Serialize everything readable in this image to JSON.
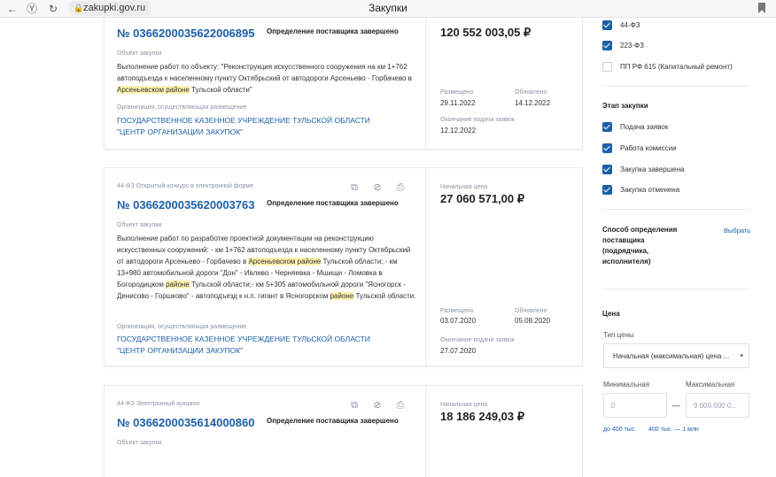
{
  "browser": {
    "url": "zakupki.gov.ru",
    "tab_title": "Закупки"
  },
  "cards": [
    {
      "reg_number": "№ 0366200035622006895",
      "status": "Определение поставщика завершено",
      "obj_label": "Объект закупки",
      "obj_text_parts": [
        "Выполнение работ по объекту: \"Реконструкция искусственного сооружения на км 1+762 автоподъезда к населенному пункту Октябрьский от автодороги Арсеньево - Горбачево в ",
        "Арсеньевском районе",
        " Тульской области\""
      ],
      "org_label": "Организация, осуществляющая размещение",
      "org_name": "ГОСУДАРСТВЕННОЕ КАЗЕННОЕ УЧРЕЖДЕНИЕ ТУЛЬСКОЙ ОБЛАСТИ \"ЦЕНТР ОРГАНИЗАЦИИ ЗАКУПОК\"",
      "price": "120 552 003,05 ₽",
      "placed_label": "Размещено",
      "placed": "29.11.2022",
      "updated_label": "Обновлено",
      "updated": "14.12.2022",
      "deadline_label": "Окончание подачи заявок",
      "deadline": "12.12.2022"
    },
    {
      "law_type": "44-ФЗ Открытый конкурс в электронной форме",
      "reg_number": "№ 0366200035620003763",
      "status": "Определение поставщика завершено",
      "obj_label": "Объект закупки",
      "obj_text_parts": [
        "Выполнение работ по разработке проектной документации на реконструкцию искусственных сооружений: - км 1+762 автоподъезда к населенному пункту Октябрьский от автодороги Арсеньево - Горбачево в ",
        "Арсеньевском районе",
        " Тульской области; - км 13+980 автомобильной дороги \"Дон\" - Ивлево - Черняевка - Мшищи - Ломовка в Богородицком ",
        "районе",
        " Тульской области;- км 5+305 автомобильной дороги \"Ясногорск - Денисово - Горшково\" - автоподъезд к н.п. гигант в Ясногорском ",
        "районе",
        " Тульской области."
      ],
      "org_label": "Организация, осуществляющая размещение",
      "org_name": "ГОСУДАРСТВЕННОЕ КАЗЕННОЕ УЧРЕЖДЕНИЕ ТУЛЬСКОЙ ОБЛАСТИ \"ЦЕНТР ОРГАНИЗАЦИИ ЗАКУПОК\"",
      "price_label": "Начальная цена",
      "price": "27 060 571,00 ₽",
      "placed_label": "Размещено",
      "placed": "03.07.2020",
      "updated_label": "Обновлено",
      "updated": "05.08.2020",
      "deadline_label": "Окончание подачи заявок",
      "deadline": "27.07.2020"
    },
    {
      "law_type": "44-ФЗ Электронный аукцион",
      "reg_number": "№ 0366200035614000860",
      "status": "Определение поставщика завершено",
      "obj_label": "Объект закупки",
      "price_label": "Начальная цена",
      "price": "18 186 249,03 ₽"
    }
  ],
  "sidebar": {
    "law_filters": [
      {
        "label": "44-ФЗ",
        "checked": true
      },
      {
        "label": "223-ФЗ",
        "checked": true
      },
      {
        "label": "ПП РФ 615 (Капитальный ремонт)",
        "checked": false
      }
    ],
    "stage_title": "Этап закупки",
    "stage_filters": [
      {
        "label": "Подача заявок",
        "checked": true
      },
      {
        "label": "Работа комиссии",
        "checked": true
      },
      {
        "label": "Закупка завершена",
        "checked": true
      },
      {
        "label": "Закупка отменена",
        "checked": true
      }
    ],
    "method_title": "Способ определения поставщика (подрядчика, исполнителя)",
    "method_link": "Выбрать",
    "price_title": "Цена",
    "price_type_label": "Тип цены",
    "price_type_value": "Начальная (максимальная) цена ...",
    "min_label": "Минимальная",
    "max_label": "Максимальная",
    "min_placeholder": "0",
    "max_placeholder": "9 000 000 0...",
    "dash": "—",
    "quick_links": [
      "до 400 тыс.",
      "400 тыс. — 1 млн"
    ]
  },
  "colors": {
    "accent": "#1c5fa8",
    "highlight": "#fff3b0"
  }
}
